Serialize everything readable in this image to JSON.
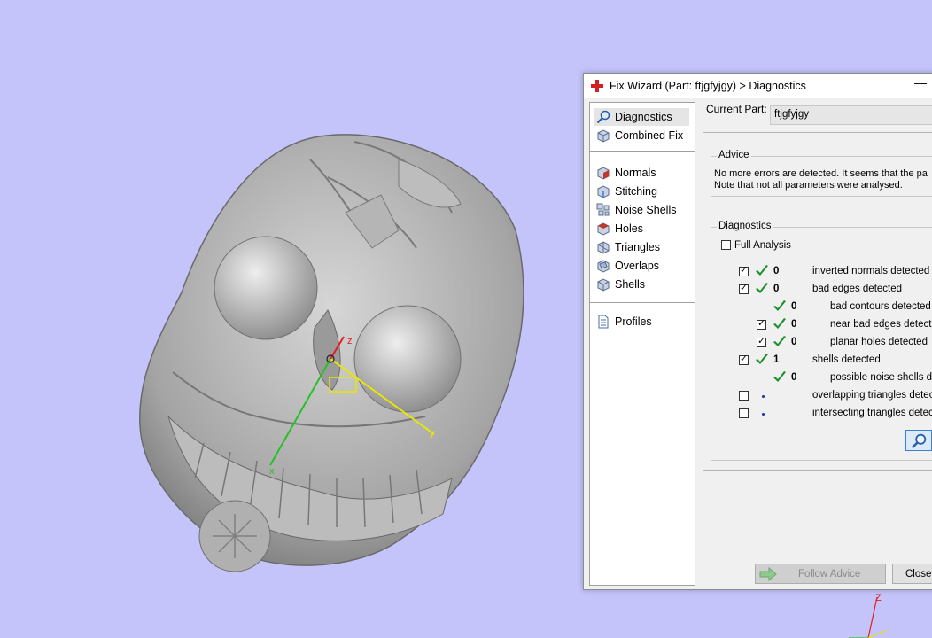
{
  "viewport": {
    "background": "#c4c4fb",
    "model_axes": {
      "x": "x",
      "y": "y",
      "z": "z"
    },
    "mini_axes": {
      "z": "Z"
    }
  },
  "dialog": {
    "title": "Fix Wizard (Part: ftjgfyjgy) > Diagnostics",
    "title_icon": "red-cross-icon",
    "minimize_symbol": "—",
    "nav": {
      "top_items": [
        {
          "label": "Diagnostics",
          "icon": "magnifier-icon",
          "selected": true
        },
        {
          "label": "Combined Fix",
          "icon": "cube-icon",
          "selected": false
        }
      ],
      "fix_items": [
        {
          "label": "Normals",
          "icon": "normals-cube-icon"
        },
        {
          "label": "Stitching",
          "icon": "stitching-cube-icon"
        },
        {
          "label": "Noise Shells",
          "icon": "noise-shells-icon"
        },
        {
          "label": "Holes",
          "icon": "holes-cube-icon"
        },
        {
          "label": "Triangles",
          "icon": "triangles-cube-icon"
        },
        {
          "label": "Overlaps",
          "icon": "overlaps-cube-icon"
        },
        {
          "label": "Shells",
          "icon": "shells-cube-icon"
        }
      ],
      "profiles_label": "Profiles"
    },
    "current_part_label": "Current Part:",
    "current_part_value": "ftjgfyjgy",
    "advice": {
      "title": "Advice",
      "line1": "No more errors are detected. It seems that the pa",
      "line2": "Note that not all parameters were analysed."
    },
    "diagnostics": {
      "title": "Diagnostics",
      "full_analysis_label": "Full Analysis",
      "full_analysis_checked": false,
      "rows": [
        {
          "checkbox": true,
          "checked": true,
          "status": "check",
          "count": "0",
          "label": "inverted normals detected",
          "indent": 0
        },
        {
          "checkbox": true,
          "checked": true,
          "status": "check",
          "count": "0",
          "label": "bad edges detected",
          "indent": 0
        },
        {
          "checkbox": false,
          "checked": false,
          "status": "check",
          "count": "0",
          "label": "bad contours detected",
          "indent": 1
        },
        {
          "checkbox": true,
          "checked": true,
          "status": "check",
          "count": "0",
          "label": "near bad edges detecte",
          "indent": 1
        },
        {
          "checkbox": true,
          "checked": true,
          "status": "check",
          "count": "0",
          "label": "planar holes detected",
          "indent": 1
        },
        {
          "checkbox": true,
          "checked": true,
          "status": "check",
          "count": "1",
          "label": "shells detected",
          "indent": 0
        },
        {
          "checkbox": false,
          "checked": false,
          "status": "check",
          "count": "0",
          "label": "possible noise shells dete",
          "indent": 1
        },
        {
          "checkbox": true,
          "checked": false,
          "status": "dot",
          "count": "",
          "label": "overlapping triangles detecte",
          "indent": 0
        },
        {
          "checkbox": true,
          "checked": false,
          "status": "dot",
          "count": "",
          "label": "intersecting triangles detecte",
          "indent": 0
        }
      ]
    },
    "analyze_button_icon": "magnifier-icon",
    "follow_advice_label": "Follow Advice",
    "close_label": "Close"
  }
}
